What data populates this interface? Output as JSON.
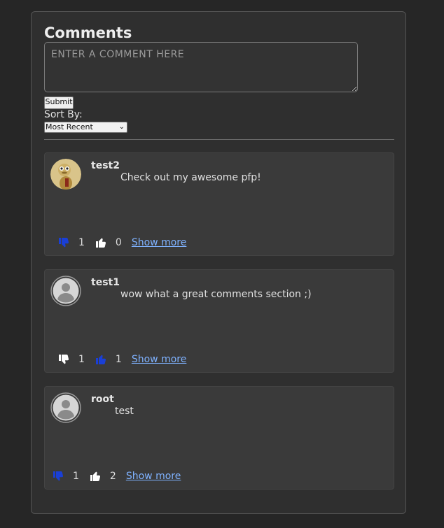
{
  "header": {
    "title": "Comments"
  },
  "compose": {
    "placeholder": "ENTER A COMMENT HERE",
    "submit_label": "Submit",
    "sort_label": "Sort By:",
    "sort_selected": "Most Recent"
  },
  "comments": [
    {
      "username": "test2",
      "text": "Check out my awesome pfp!",
      "avatar": "custom-profile-picture",
      "dislikes": "1",
      "likes": "0",
      "show_more": "Show more",
      "dislike_active": true,
      "like_active": false
    },
    {
      "username": "test1",
      "text": "wow what a great comments section ;)",
      "avatar": "default-user-icon",
      "dislikes": "1",
      "likes": "1",
      "show_more": "Show more",
      "dislike_active": false,
      "like_active": true
    },
    {
      "username": "root",
      "text": "test",
      "avatar": "default-user-icon",
      "dislikes": "1",
      "likes": "2",
      "show_more": "Show more",
      "dislike_active": true,
      "like_active": false
    }
  ],
  "colors": {
    "active_vote": "#1a3fd6",
    "inactive_vote": "#ffffff",
    "link": "#7fb2ff"
  }
}
